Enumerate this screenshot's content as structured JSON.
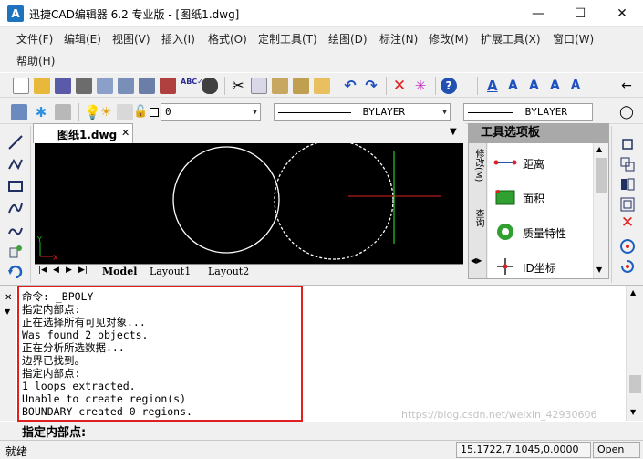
{
  "window": {
    "app_icon": "A",
    "title": "迅捷CAD编辑器 6.2 专业版  - [图纸1.dwg]",
    "minimize": "—",
    "maximize": "☐",
    "close": "✕"
  },
  "menu": [
    "文件(F)",
    "编辑(E)",
    "视图(V)",
    "插入(I)",
    "格式(O)",
    "定制工具(T)",
    "绘图(D)",
    "标注(N)",
    "修改(M)",
    "扩展工具(X)",
    "窗口(W)",
    "帮助(H)"
  ],
  "layer_toolbar": {
    "layer_value": "0",
    "linetype_value": "BYLAYER",
    "lineweight_value": "BYLAYER"
  },
  "document": {
    "tab_label": "图纸1.dwg",
    "tab_close": "✕",
    "layouts": [
      "Model",
      "Layout1",
      "Layout2"
    ]
  },
  "palette": {
    "title": "工具选项板",
    "side_tabs": [
      "修改(M)",
      "查询"
    ],
    "items": [
      {
        "label": "距离",
        "icon": "distance-icon"
      },
      {
        "label": "面积",
        "icon": "area-icon"
      },
      {
        "label": "质量特性",
        "icon": "mass-properties-icon"
      },
      {
        "label": "ID坐标",
        "icon": "id-coordinate-icon"
      }
    ]
  },
  "command": {
    "history": [
      "命令:  _BPOLY",
      "指定内部点:",
      "正在选择所有可见对象...",
      "Was found 2 objects.",
      "正在分析所选数据...",
      "边界已找到。",
      "指定内部点:",
      "1 loops extracted.",
      "Unable to create region(s)",
      "BOUNDARY created 0 regions."
    ],
    "prompt": "指定内部点:"
  },
  "status": {
    "left_text": "就绪",
    "coordinates": "15.1722,7.1045,0.0000",
    "open_label": "Open",
    "watermark": "https://blog.csdn.net/weixin_42930606"
  },
  "colors": {
    "accent": "#1e73be",
    "highlight_box": "#e02020",
    "crosshair_h": "#e02020",
    "crosshair_v": "#20c020"
  }
}
